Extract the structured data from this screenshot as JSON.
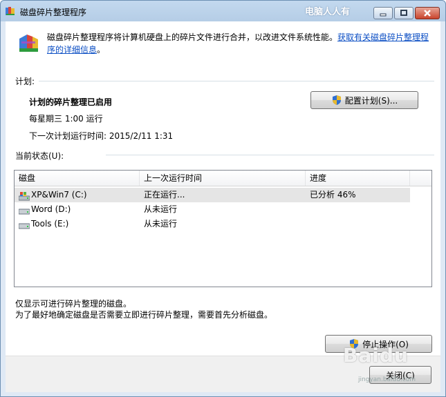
{
  "window": {
    "title": "磁盘碎片整理程序",
    "watermark": "电脑人人有"
  },
  "header": {
    "description": "磁盘碎片整理程序将计算机硬盘上的碎片文件进行合并，以改进文件系统性能。",
    "link_text": "获取有关磁盘碎片整理程序的详细信息",
    "period": "。"
  },
  "schedule": {
    "section_label": "计划:",
    "status": "计划的碎片整理已启用",
    "frequency": "每星期三  1:00 运行",
    "next_run": "下一次计划运行时间: 2015/2/11 1:31",
    "configure_button": "配置计划(S)..."
  },
  "current_status": {
    "section_label": "当前状态(U):",
    "columns": [
      "磁盘",
      "上一次运行时间",
      "进度"
    ],
    "rows": [
      {
        "disk": "XP&Win7 (C:)",
        "last_run": "正在运行...",
        "progress": "已分析 46%",
        "icon": "system-drive-icon",
        "selected": true
      },
      {
        "disk": "Word (D:)",
        "last_run": "从未运行",
        "progress": "",
        "icon": "drive-icon",
        "selected": false
      },
      {
        "disk": "Tools (E:)",
        "last_run": "从未运行",
        "progress": "",
        "icon": "drive-icon",
        "selected": false
      }
    ]
  },
  "notes": {
    "line1": "仅显示可进行碎片整理的磁盘。",
    "line2": "为了最好地确定磁盘是否需要立即进行碎片整理，需要首先分析磁盘。"
  },
  "buttons": {
    "stop": "停止操作(O)",
    "close": "关闭(C)"
  },
  "watermark_bottom": {
    "brand": "Baidu",
    "sub": "jingyan.baidu.com"
  },
  "colors": {
    "link": "#0b4ec4",
    "titlebar": "#c3d9ef",
    "selected_row": "#e5e5e5"
  }
}
